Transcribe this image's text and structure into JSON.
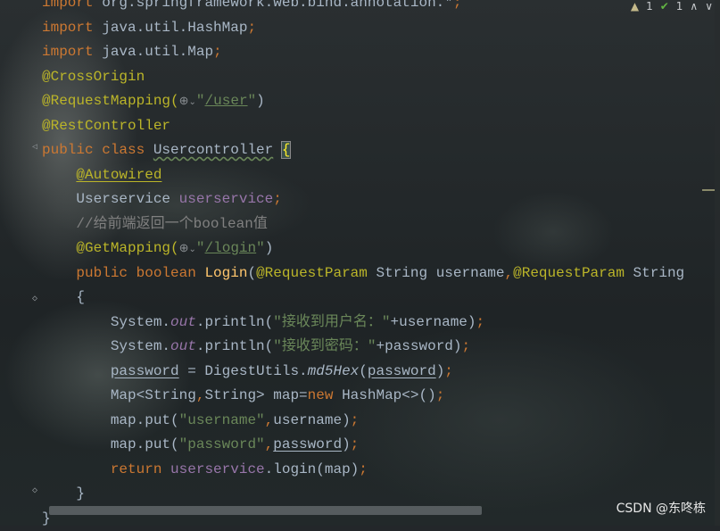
{
  "editor": {
    "lines": [
      [
        {
          "t": "import ",
          "c": "kw"
        },
        {
          "t": "org.springframework.web.bind.annotation.*",
          "c": "cls"
        },
        {
          "t": ";",
          "c": "kw"
        }
      ],
      [
        {
          "t": "import ",
          "c": "kw"
        },
        {
          "t": "java.util.HashMap",
          "c": "cls"
        },
        {
          "t": ";",
          "c": "kw"
        }
      ],
      [
        {
          "t": "import ",
          "c": "kw"
        },
        {
          "t": "java.util.Map",
          "c": "cls"
        },
        {
          "t": ";",
          "c": "kw"
        }
      ],
      [
        {
          "t": "@CrossOrigin",
          "c": "ann"
        }
      ],
      [
        {
          "t": "@RequestMapping(",
          "c": "ann"
        },
        {
          "t": "⊕",
          "c": "globe-icon",
          "name": "globe-icon"
        },
        {
          "t": "⌄",
          "c": "caret-icon",
          "name": "chevron-down-icon"
        },
        {
          "t": "\"",
          "c": "str"
        },
        {
          "t": "/user",
          "c": "url"
        },
        {
          "t": "\"",
          "c": "str"
        },
        {
          "t": ")",
          "c": "cls"
        }
      ],
      [
        {
          "t": "@RestController",
          "c": "ann"
        }
      ],
      [
        {
          "t": "public class ",
          "c": "kw"
        },
        {
          "t": "Usercontroller",
          "c": "cls squiggle"
        },
        {
          "t": " ",
          "c": "cls"
        },
        {
          "t": "{",
          "c": "brace-hl"
        }
      ],
      [
        {
          "t": "    ",
          "c": "cls"
        },
        {
          "t": "@Autowired",
          "c": "ann uline"
        }
      ],
      [
        {
          "t": "    Userservice ",
          "c": "cls"
        },
        {
          "t": "userservice",
          "c": "field"
        },
        {
          "t": ";",
          "c": "kw"
        }
      ],
      [
        {
          "t": "    //给前端返回一个boolean值",
          "c": "comment"
        }
      ],
      [
        {
          "t": "    @GetMapping(",
          "c": "ann"
        },
        {
          "t": "⊕",
          "c": "globe-icon",
          "name": "globe-icon"
        },
        {
          "t": "⌄",
          "c": "caret-icon",
          "name": "chevron-down-icon"
        },
        {
          "t": "\"",
          "c": "str"
        },
        {
          "t": "/login",
          "c": "url"
        },
        {
          "t": "\"",
          "c": "str"
        },
        {
          "t": ")",
          "c": "cls"
        }
      ],
      [
        {
          "t": "    ",
          "c": "cls"
        },
        {
          "t": "public boolean ",
          "c": "kw"
        },
        {
          "t": "Login",
          "c": "method"
        },
        {
          "t": "(",
          "c": "cls"
        },
        {
          "t": "@RequestParam ",
          "c": "ann"
        },
        {
          "t": "String username",
          "c": "cls"
        },
        {
          "t": ",",
          "c": "kw"
        },
        {
          "t": "@RequestParam ",
          "c": "ann"
        },
        {
          "t": "String",
          "c": "cls"
        }
      ],
      [
        {
          "t": "    {",
          "c": "cls"
        }
      ],
      [
        {
          "t": "        System.",
          "c": "cls"
        },
        {
          "t": "out",
          "c": "static-field"
        },
        {
          "t": ".println(",
          "c": "cls"
        },
        {
          "t": "\"接收到用户名：\"",
          "c": "str"
        },
        {
          "t": "+username)",
          "c": "cls"
        },
        {
          "t": ";",
          "c": "kw"
        }
      ],
      [
        {
          "t": "        System.",
          "c": "cls"
        },
        {
          "t": "out",
          "c": "static-field"
        },
        {
          "t": ".println(",
          "c": "cls"
        },
        {
          "t": "\"接收到密码：\"",
          "c": "str"
        },
        {
          "t": "+password)",
          "c": "cls"
        },
        {
          "t": ";",
          "c": "kw"
        }
      ],
      [
        {
          "t": "        ",
          "c": "cls"
        },
        {
          "t": "password",
          "c": "cls uline"
        },
        {
          "t": " = DigestUtils.",
          "c": "cls"
        },
        {
          "t": "md5Hex",
          "c": "static-method"
        },
        {
          "t": "(",
          "c": "cls"
        },
        {
          "t": "password",
          "c": "cls uline"
        },
        {
          "t": ")",
          "c": "cls"
        },
        {
          "t": ";",
          "c": "kw"
        }
      ],
      [
        {
          "t": "        Map<String",
          "c": "cls"
        },
        {
          "t": ",",
          "c": "kw"
        },
        {
          "t": "String> map=",
          "c": "cls"
        },
        {
          "t": "new ",
          "c": "kw"
        },
        {
          "t": "HashMap<>()",
          "c": "cls"
        },
        {
          "t": ";",
          "c": "kw"
        }
      ],
      [
        {
          "t": "        map.put(",
          "c": "cls"
        },
        {
          "t": "\"username\"",
          "c": "str"
        },
        {
          "t": ",",
          "c": "kw"
        },
        {
          "t": "username)",
          "c": "cls"
        },
        {
          "t": ";",
          "c": "kw"
        }
      ],
      [
        {
          "t": "        map.put(",
          "c": "cls"
        },
        {
          "t": "\"password\"",
          "c": "str"
        },
        {
          "t": ",",
          "c": "kw"
        },
        {
          "t": "password",
          "c": "cls uline"
        },
        {
          "t": ")",
          "c": "cls"
        },
        {
          "t": ";",
          "c": "kw"
        }
      ],
      [
        {
          "t": "        ",
          "c": "cls"
        },
        {
          "t": "return ",
          "c": "kw"
        },
        {
          "t": "userservice",
          "c": "field"
        },
        {
          "t": ".login(map)",
          "c": "cls"
        },
        {
          "t": ";",
          "c": "kw"
        }
      ],
      [
        {
          "t": "    }",
          "c": "cls"
        }
      ],
      [
        {
          "t": "}",
          "c": "cls"
        }
      ]
    ]
  },
  "inspection": {
    "warn_count": "1",
    "check_count": "1"
  },
  "watermark": "CSDN @东咚栋"
}
